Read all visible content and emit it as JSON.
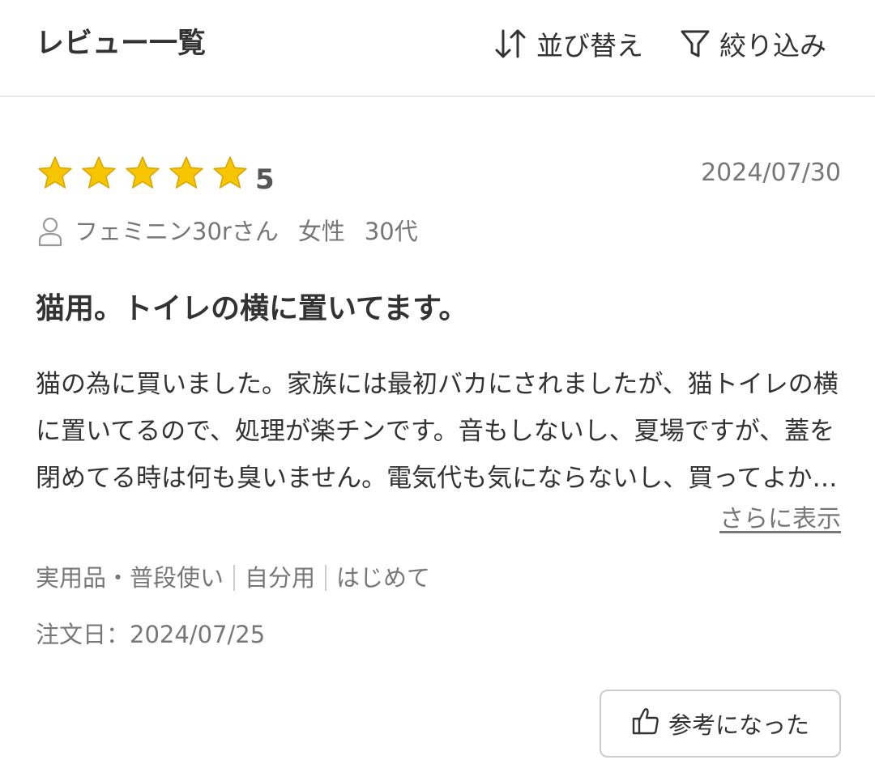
{
  "header": {
    "title": "レビュー一覧",
    "sort_label": "並び替え",
    "filter_label": "絞り込み"
  },
  "review": {
    "rating": 5,
    "rating_text": "5",
    "star_color": "#f7c600",
    "date": "2024/07/30",
    "reviewer": {
      "name": "フェミニン30rさん",
      "gender": "女性",
      "age": "30代"
    },
    "title": "猫用。トイレの横に置いてます。",
    "body": "猫の為に買いました。家族には最初バカにされましたが、猫トイレの横に置いてるので、処理が楽チンです。音もしないし、夏場ですが、蓋を閉めてる時は何も臭いません。電気代も気にならないし、買ってよかったです。",
    "show_more": "さらに表示",
    "tags": [
      "実用品・普段使い",
      "自分用",
      "はじめて"
    ],
    "order_date": "注文日：2024/07/25",
    "helpful_label": "参考になった"
  }
}
